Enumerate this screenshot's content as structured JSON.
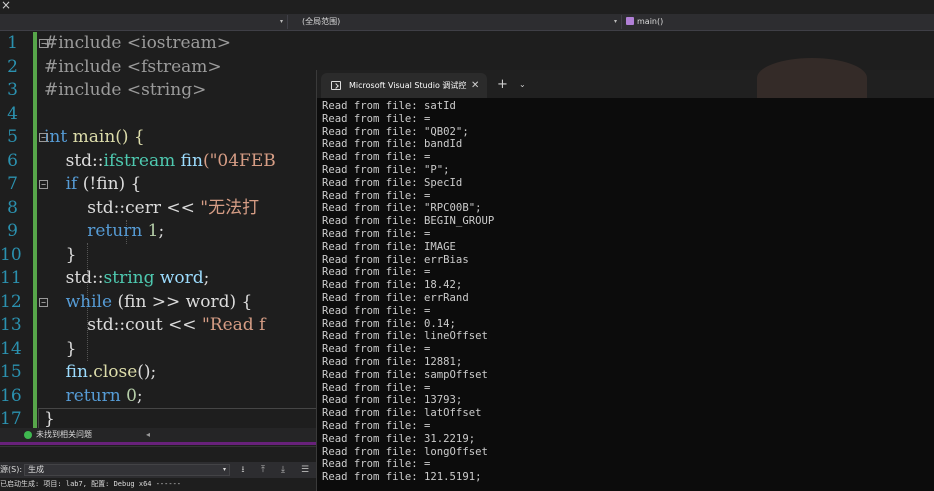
{
  "top": {
    "close_glyph": "×"
  },
  "navbar": {
    "project_dropdown": "",
    "scope_dropdown": "(全局范围)",
    "member_dropdown": "main()",
    "arrow": "▾"
  },
  "editor": {
    "line_numbers": [
      "1",
      "2",
      "3",
      "4",
      "5",
      "6",
      "7",
      "8",
      "9",
      "10",
      "11",
      "12",
      "13",
      "14",
      "15",
      "16",
      "17"
    ],
    "code": {
      "l1": "#include <iostream>",
      "l2": "#include <fstream>",
      "l3": "#include <string>",
      "l5_kw": "int",
      "l5_rest": " main() {",
      "l6_pre": "    std::",
      "l6_type": "ifstream",
      "l6_var": " fin",
      "l6_str": "(\"04FEB",
      "l7_kw": "    if",
      "l7_rest": " (!fin) {",
      "l8_pre": "        std::cerr << ",
      "l8_str": "\"无法打",
      "l9_kw": "        return",
      "l9_num": " 1",
      "l9_rest": ";",
      "l10": "    }",
      "l11_pre": "    std::",
      "l11_type": "string",
      "l11_var": " word",
      "l11_rest": ";",
      "l12_kw": "    while",
      "l12_rest": " (fin >> word) {",
      "l13_pre": "        std::cout << ",
      "l13_str": "\"Read f",
      "l14": "    }",
      "l15_var": "    fin",
      "l15_fn": ".close",
      "l15_rest": "();",
      "l16_kw": "    return",
      "l16_num": " 0",
      "l16_rest": ";",
      "l17": "}"
    }
  },
  "status": {
    "issues_text": "未找到相关问题",
    "scroll_arrow": "◂"
  },
  "output": {
    "source_label": "源(S):",
    "source_value": "生成",
    "source_arrow": "▾",
    "text": "已启动生成: 项目: lab7, 配置: Debug x64 ------"
  },
  "terminal": {
    "tab_title": "Microsoft Visual Studio 调试控",
    "close_glyph": "✕",
    "new_tab_glyph": "+",
    "dropdown_glyph": "⌄",
    "lines": [
      "Read from file: satId",
      "Read from file: =",
      "Read from file: \"QB02\";",
      "Read from file: bandId",
      "Read from file: =",
      "Read from file: \"P\";",
      "Read from file: SpecId",
      "Read from file: =",
      "Read from file: \"RPC00B\";",
      "Read from file: BEGIN_GROUP",
      "Read from file: =",
      "Read from file: IMAGE",
      "Read from file: errBias",
      "Read from file: =",
      "Read from file: 18.42;",
      "Read from file: errRand",
      "Read from file: =",
      "Read from file: 0.14;",
      "Read from file: lineOffset",
      "Read from file: =",
      "Read from file: 12881;",
      "Read from file: sampOffset",
      "Read from file: =",
      "Read from file: 13793;",
      "Read from file: latOffset",
      "Read from file: =",
      "Read from file: 31.2219;",
      "Read from file: longOffset",
      "Read from file: =",
      "Read from file: 121.5191;"
    ]
  }
}
